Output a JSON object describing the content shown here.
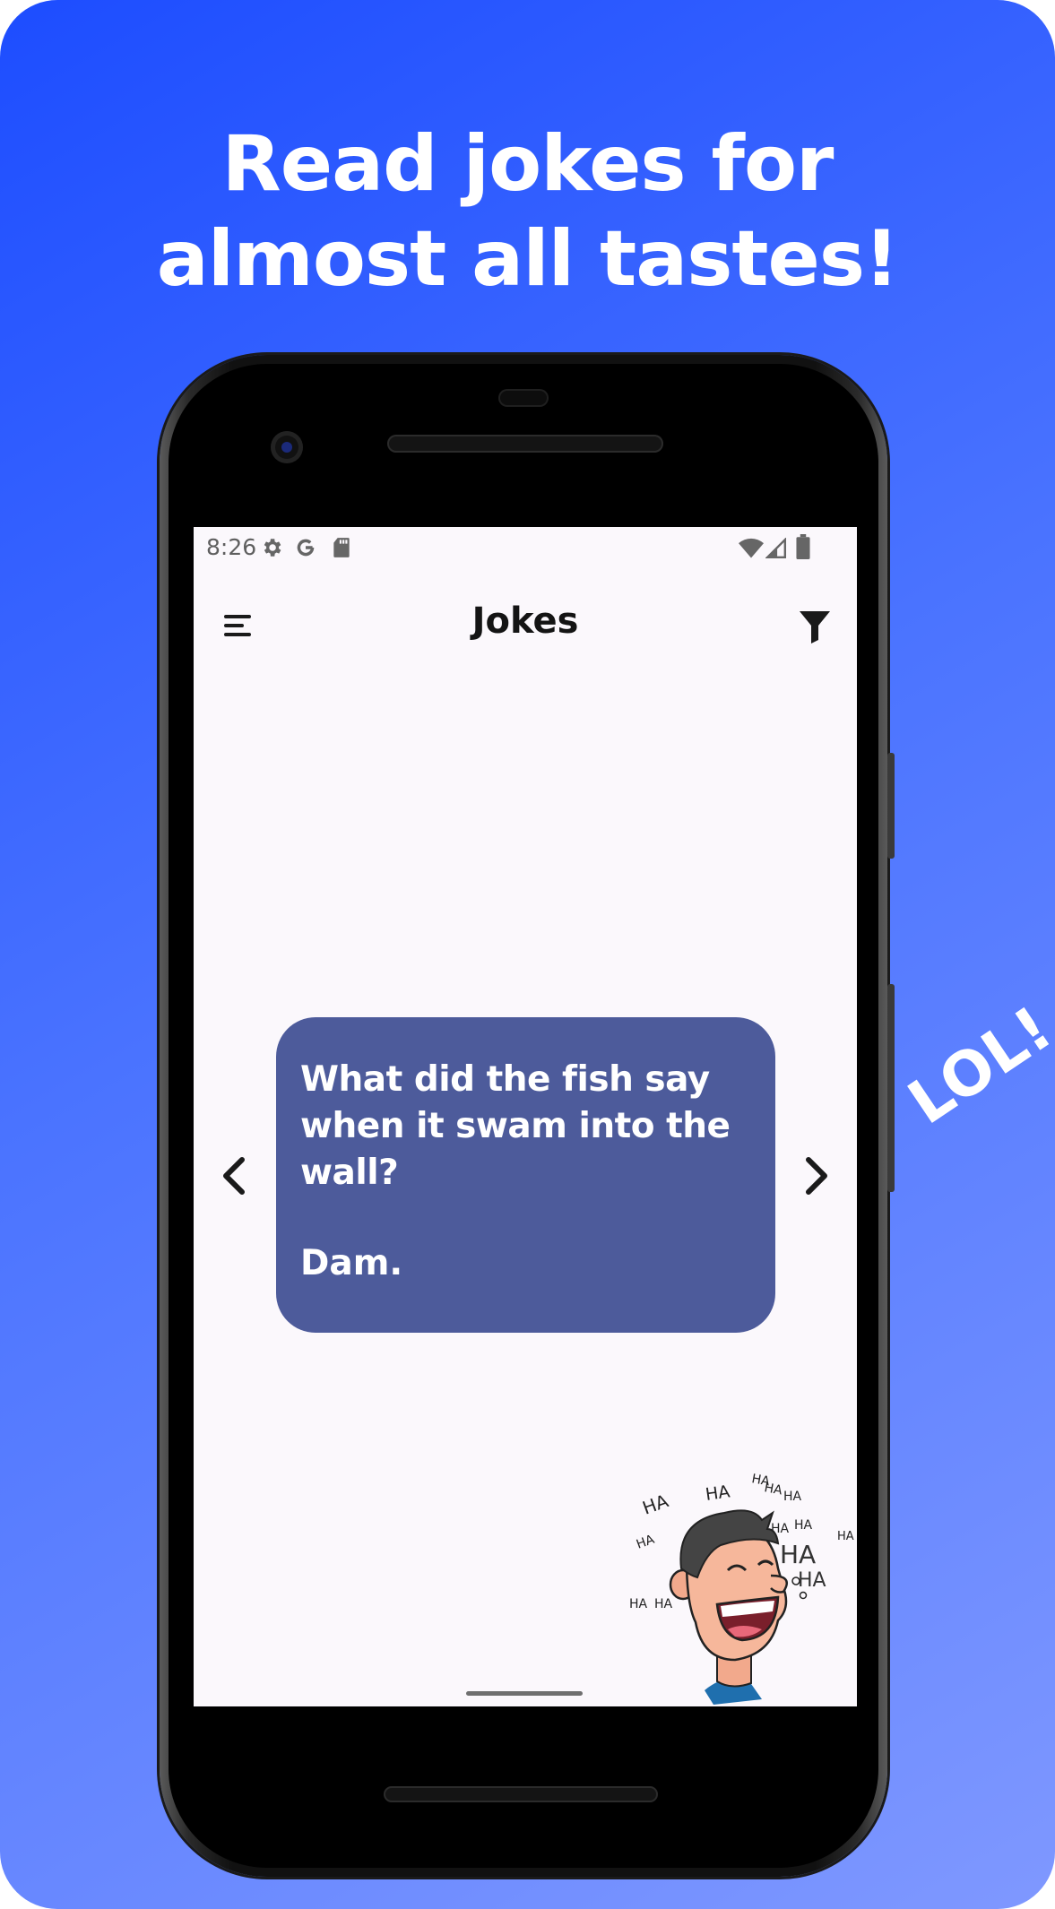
{
  "promo": {
    "headline_line1": "Read jokes for",
    "headline_line2": "almost all tastes!",
    "badge": "LOL!"
  },
  "status_bar": {
    "time": "8:26",
    "icons": [
      "settings-icon",
      "google-icon",
      "sd-card-icon",
      "wifi-icon",
      "signal-icon",
      "battery-icon"
    ]
  },
  "app_bar": {
    "title": "Jokes",
    "menu_icon": "menu-icon",
    "filter_icon": "filter-icon"
  },
  "joke": {
    "question": "What did the fish say when it swam into the wall?",
    "answer": "Dam.",
    "card_color": "#4d5b9b"
  },
  "navigation": {
    "prev_icon": "chevron-left-icon",
    "next_icon": "chevron-right-icon"
  },
  "illustration": {
    "name": "laughing-man",
    "ha_text": "HA"
  },
  "colors": {
    "background_start": "#1d4dff",
    "background_end": "#7f98ff",
    "screen_bg": "#fbf8fc"
  }
}
